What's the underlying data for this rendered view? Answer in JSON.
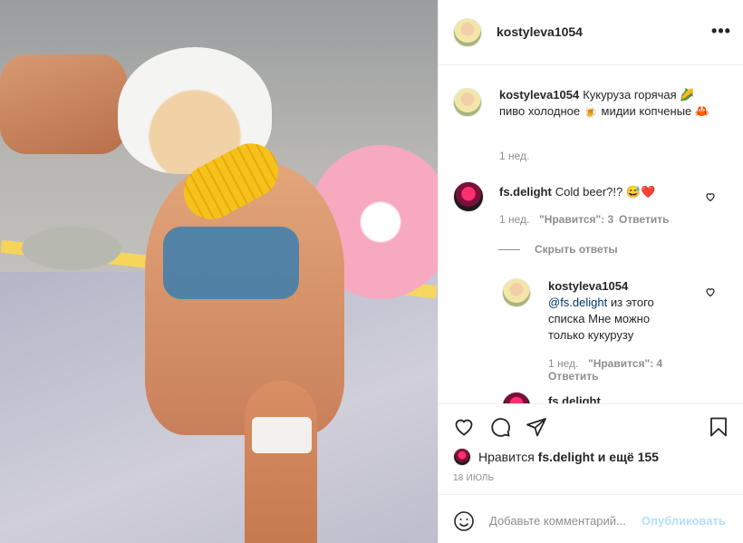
{
  "header": {
    "username": "kostyleva1054",
    "more_icon": "more-horizontal-icon"
  },
  "caption": {
    "username": "kostyleva1054",
    "text": "Кукуруза горячая 🌽 пиво холодное 🍺 мидии копченые 🦀",
    "time": "1 нед."
  },
  "comments": [
    {
      "username": "fs.delight",
      "text": "Cold beer?!? 😅❤️",
      "time": "1 нед.",
      "likes": "\"Нравится\": 3",
      "reply": "Ответить"
    }
  ],
  "hide_replies": "Скрыть ответы",
  "replies": [
    {
      "username": "kostyleva1054",
      "mention": "@fs.delight",
      "text": "из этого списка Мне можно только кукурузу",
      "time": "1 нед.",
      "likes": "\"Нравится\": 4",
      "reply": "Ответить"
    },
    {
      "username": "fs.delight"
    }
  ],
  "actions": {
    "like_icon": "heart-icon",
    "comment_icon": "comment-icon",
    "share_icon": "send-icon",
    "save_icon": "bookmark-icon"
  },
  "likes": {
    "prefix": "Нравится",
    "user": "fs.delight",
    "suffix": "и ещё 155"
  },
  "date": "18 ИЮЛЬ",
  "add_comment": {
    "placeholder": "Добавьте комментарий...",
    "post_label": "Опубликовать"
  },
  "colors": {
    "link": "#00376b",
    "post_button_disabled": "#b2dffc",
    "secondary_text": "#8e8e8e",
    "border": "#efefef"
  }
}
